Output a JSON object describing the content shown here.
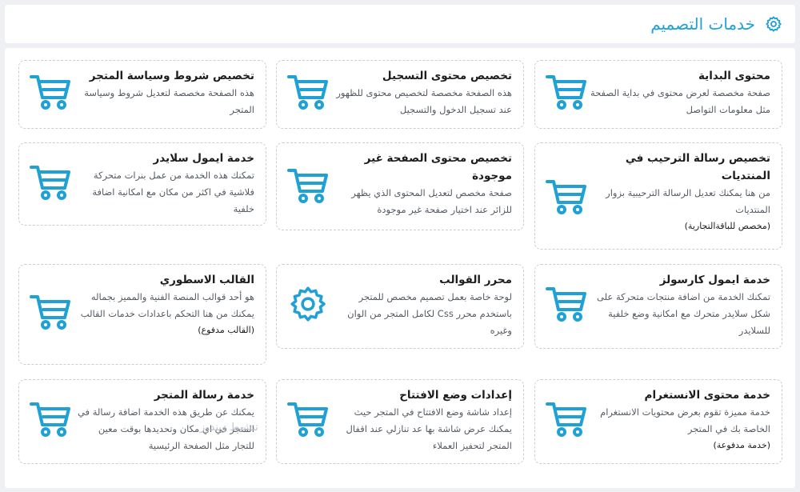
{
  "header": {
    "title": "خدمات التصميم",
    "icon": "gear-icon"
  },
  "colors": {
    "accent": "#1fa1d6",
    "title": "#1d1d1d",
    "desc": "#555b63"
  },
  "cards": [
    {
      "title": "محتوى البداية",
      "desc": "صفحة مخصصة لعرض محتوى في بداية الصفحة مثل معلومات التواصل",
      "note": "",
      "icon": "cart-icon"
    },
    {
      "title": "تخصيص محتوى التسجيل",
      "desc": "هذه الصفحة مخصصة لتخصيص محتوى للظهور عند تسجيل الدخول والتسجيل",
      "note": "",
      "icon": "cart-icon"
    },
    {
      "title": "تخصيص شروط وسياسة المتجر",
      "desc": "هذه الصفحة مخصصة لتعديل شروط وسياسة المتجر",
      "note": "",
      "icon": "cart-icon"
    },
    {
      "title": "تخصيص رسالة الترحيب في المنتديات",
      "desc": "من هنا يمكنك تعديل الرسالة الترحيبية بزوار المنتديات",
      "note": "(مخصص للباقةالتجارية)",
      "icon": "cart-icon"
    },
    {
      "title": "تخصيص محتوى الصفحة غير موجودة",
      "desc": "صفحة مخصص لتعديل المحتوى الذي يظهر للزائر عند اختيار صفحة غير موجودة",
      "note": "",
      "icon": "cart-icon"
    },
    {
      "title": "خدمة ايمول سلايدر",
      "desc": "تمكنك هذه الخدمة من عمل بنرات متحركة فلاشية في اكثر من مكان مع امكانية اضافة خلفية",
      "note": "",
      "icon": "cart-icon"
    },
    {
      "title": "خدمة ايمول كارسولز",
      "desc": "تمكنك الخدمة من اضافة منتجات متحركة على شكل سلايدر متحرك مع امكانية وضع خلفية للسلايدر",
      "note": "",
      "icon": "cart-icon"
    },
    {
      "title": "محرر القوالب",
      "desc": "لوحة خاصة بعمل تصميم مخصص للمتجر باستخدم محرر Css لكامل المتجر من الوان وغيره",
      "note": "",
      "icon": "gear-icon"
    },
    {
      "title": "القالب الاسطوري",
      "desc": "هو أحد قوالب المنصة الفنية والمميز بجماله يمكنك من هنا التحكم باعدادات خدمات القالب",
      "note": "(القالب مدفوع)",
      "icon": "cart-icon"
    },
    {
      "title": "خدمة محتوى الانستغرام",
      "desc": "خدمة مميزة تقوم بعرض محتويات الانستغرام الخاصة بك في المتجر",
      "note": "(خدمة مدفوعة)",
      "icon": "cart-icon"
    },
    {
      "title": "إعدادات وضع الافتتاح",
      "desc": "إعداد شاشة وضع الافتتاح في المتجر حيث يمكنك عرض شاشة بها عد تنازلي عند اقفال المتجر لتحفيز العملاء",
      "note": "",
      "icon": "cart-icon"
    },
    {
      "title": "خدمة رسالة المتجر",
      "desc": "يمكنك عن طريق هذه الخدمة اضافة رسالة في المتجر في اي مكان وتحديدها بوقت معين للتجار مثل الصفحة الرئيسية",
      "note": "",
      "icon": "cart-icon"
    }
  ],
  "watermark": "تنشيط ويندوز"
}
